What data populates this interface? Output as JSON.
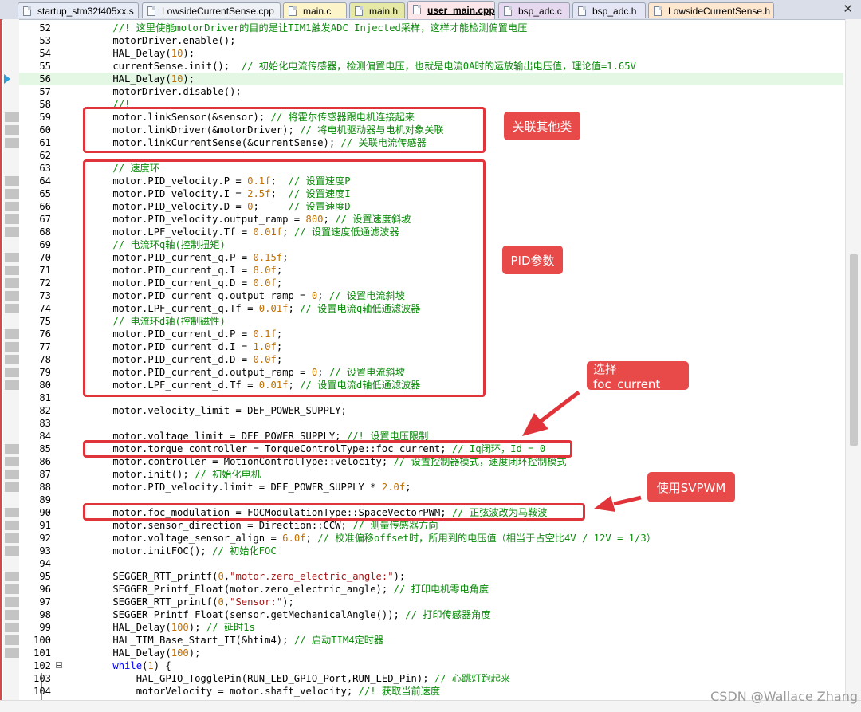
{
  "tabs": [
    {
      "label": "startup_stm32f405xx.s",
      "color": "#e6ebf5",
      "active": false
    },
    {
      "label": "LowsideCurrentSense.cpp",
      "color": "#eef1f6",
      "active": false
    },
    {
      "label": "main.c",
      "color": "#fdf4c9",
      "active": false
    },
    {
      "label": "main.h",
      "color": "#e6e8a6",
      "active": false
    },
    {
      "label": "user_main.cpp",
      "color": "#fbe7e9",
      "active": true
    },
    {
      "label": "bsp_adc.c",
      "color": "#e5d8ef",
      "active": false
    },
    {
      "label": "bsp_adc.h",
      "color": "#e4e6f6",
      "active": false
    },
    {
      "label": "LowsideCurrentSense.h",
      "color": "#fde7cf",
      "active": false
    }
  ],
  "close_glyph": "✕",
  "lines": [
    {
      "num": "52",
      "code": "    //! 这里使能motorDriver的目的是让TIM1触发ADC Injected采样，这样才能检测偏置电压"
    },
    {
      "num": "53",
      "code": "    motorDriver.enable();"
    },
    {
      "num": "54",
      "code": "    HAL_Delay(10);"
    },
    {
      "num": "55",
      "code": "    currentSense.init();  // 初始化电流传感器，检测偏置电压，也就是电流0A时的运放输出电压值，理论值=1.65V"
    },
    {
      "num": "56",
      "code": "    HAL_Delay(10);"
    },
    {
      "num": "57",
      "code": "    motorDriver.disable();"
    },
    {
      "num": "58",
      "code": "    //!"
    },
    {
      "num": "59",
      "code": "    motor.linkSensor(&sensor); // 将霍尔传感器跟电机连接起来"
    },
    {
      "num": "60",
      "code": "    motor.linkDriver(&motorDriver); // 将电机驱动器与电机对象关联"
    },
    {
      "num": "61",
      "code": "    motor.linkCurrentSense(&currentSense); // 关联电流传感器"
    },
    {
      "num": "62",
      "code": ""
    },
    {
      "num": "63",
      "code": "    // 速度环"
    },
    {
      "num": "64",
      "code": "    motor.PID_velocity.P = 0.1f;  // 设置速度P"
    },
    {
      "num": "65",
      "code": "    motor.PID_velocity.I = 2.5f;  // 设置速度I"
    },
    {
      "num": "66",
      "code": "    motor.PID_velocity.D = 0;     // 设置速度D"
    },
    {
      "num": "67",
      "code": "    motor.PID_velocity.output_ramp = 800; // 设置速度斜坡"
    },
    {
      "num": "68",
      "code": "    motor.LPF_velocity.Tf = 0.01f; // 设置速度低通滤波器"
    },
    {
      "num": "69",
      "code": "    // 电流环q轴(控制扭矩)"
    },
    {
      "num": "70",
      "code": "    motor.PID_current_q.P = 0.15f;"
    },
    {
      "num": "71",
      "code": "    motor.PID_current_q.I = 8.0f;"
    },
    {
      "num": "72",
      "code": "    motor.PID_current_q.D = 0.0f;"
    },
    {
      "num": "73",
      "code": "    motor.PID_current_q.output_ramp = 0; // 设置电流斜坡"
    },
    {
      "num": "74",
      "code": "    motor.LPF_current_q.Tf = 0.01f; // 设置电流q轴低通滤波器"
    },
    {
      "num": "75",
      "code": "    // 电流环d轴(控制磁性)"
    },
    {
      "num": "76",
      "code": "    motor.PID_current_d.P = 0.1f;"
    },
    {
      "num": "77",
      "code": "    motor.PID_current_d.I = 1.0f;"
    },
    {
      "num": "78",
      "code": "    motor.PID_current_d.D = 0.0f;"
    },
    {
      "num": "79",
      "code": "    motor.PID_current_d.output_ramp = 0; // 设置电流斜坡"
    },
    {
      "num": "80",
      "code": "    motor.LPF_current_d.Tf = 0.01f; // 设置电流d轴低通滤波器"
    },
    {
      "num": "81",
      "code": ""
    },
    {
      "num": "82",
      "code": "    motor.velocity_limit = DEF_POWER_SUPPLY;"
    },
    {
      "num": "83",
      "code": ""
    },
    {
      "num": "84",
      "code": "    motor.voltage_limit = DEF_POWER_SUPPLY; //! 设置电压限制"
    },
    {
      "num": "85",
      "code": "    motor.torque_controller = TorqueControlType::foc_current; // Iq闭环，Id = 0"
    },
    {
      "num": "86",
      "code": "    motor.controller = MotionControlType::velocity; // 设置控制器模式，速度闭环控制模式"
    },
    {
      "num": "87",
      "code": "    motor.init(); // 初始化电机"
    },
    {
      "num": "88",
      "code": "    motor.PID_velocity.limit = DEF_POWER_SUPPLY * 2.0f;"
    },
    {
      "num": "89",
      "code": ""
    },
    {
      "num": "90",
      "code": "    motor.foc_modulation = FOCModulationType::SpaceVectorPWM; // 正弦波改为马鞍波"
    },
    {
      "num": "91",
      "code": "    motor.sensor_direction = Direction::CCW; // 测量传感器方向"
    },
    {
      "num": "92",
      "code": "    motor.voltage_sensor_align = 6.0f; // 校准偏移offset时，所用到的电压值（相当于占空比4V / 12V = 1/3）"
    },
    {
      "num": "93",
      "code": "    motor.initFOC(); // 初始化FOC"
    },
    {
      "num": "94",
      "code": ""
    },
    {
      "num": "95",
      "code": "    SEGGER_RTT_printf(0,\"motor.zero_electric_angle:\");"
    },
    {
      "num": "96",
      "code": "    SEGGER_Printf_Float(motor.zero_electric_angle); // 打印电机零电角度"
    },
    {
      "num": "97",
      "code": "    SEGGER_RTT_printf(0,\"Sensor:\");"
    },
    {
      "num": "98",
      "code": "    SEGGER_Printf_Float(sensor.getMechanicalAngle()); // 打印传感器角度"
    },
    {
      "num": "99",
      "code": "    HAL_Delay(100); // 延时1s"
    },
    {
      "num": "100",
      "code": "    HAL_TIM_Base_Start_IT(&htim4); // 启动TIM4定时器"
    },
    {
      "num": "101",
      "code": "    HAL_Delay(100);"
    },
    {
      "num": "102",
      "code": "    while(1) {"
    },
    {
      "num": "103",
      "code": "        HAL_GPIO_TogglePin(RUN_LED_GPIO_Port,RUN_LED_Pin); // 心跳灯跑起来"
    },
    {
      "num": "104",
      "code": "        motorVelocity = motor.shaft_velocity; //! 获取当前速度"
    }
  ],
  "annotations": {
    "link_label": "关联其他类",
    "pid_label": "PID参数",
    "foc_current_label": "选择foc_current",
    "svpwm_label": "使用SVPWM"
  },
  "colors": {
    "annotation_red": "#e0343a",
    "comment_green": "#0a8a0a",
    "number_orange": "#c07000",
    "string_red": "#a31515",
    "keyword_blue": "#0000ff",
    "current_line_bg": "#e4f7e4"
  },
  "watermark": "CSDN @Wallace Zhang"
}
